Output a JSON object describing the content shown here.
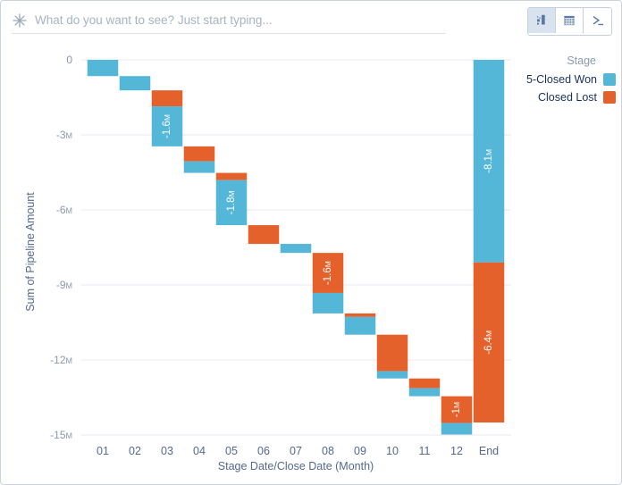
{
  "window": {
    "border_color": "#c9d2dc"
  },
  "search": {
    "placeholder": "What do you want to see? Just start typing...",
    "value": "",
    "icon": "sparkle-icon"
  },
  "toolbar": {
    "buttons": [
      {
        "name": "chart-view-button",
        "icon": "chart-icon",
        "active": true
      },
      {
        "name": "table-view-button",
        "icon": "table-grid-icon",
        "active": false
      },
      {
        "name": "console-view-button",
        "icon": "terminal-icon",
        "active": false
      }
    ]
  },
  "legend": {
    "title": "Stage",
    "items": [
      {
        "label": "5-Closed Won",
        "color": "#54b7d8"
      },
      {
        "label": "Closed Lost",
        "color": "#e4612c"
      }
    ]
  },
  "colors": {
    "won": "#54b7d8",
    "lost": "#e4612c",
    "gridline": "#e4eaf2",
    "axis_text": "#8a99ae",
    "axis_title": "#54698d",
    "toolbar_active": "#d8e3ef"
  },
  "chart_data": {
    "type": "bar",
    "subtype": "stacked-waterfall",
    "title": "",
    "xlabel": "Stage Date/Close Date (Month)",
    "ylabel": "Sum of Pipeline Amount",
    "ylim": [
      -15000000,
      0
    ],
    "yticks": [
      0,
      -3000000,
      -6000000,
      -9000000,
      -12000000,
      -15000000
    ],
    "ytick_labels": [
      "0",
      "-3M",
      "-6M",
      "-9M",
      "-12M",
      "-15M"
    ],
    "grid": true,
    "legend_position": "right",
    "categories": [
      "01",
      "02",
      "03",
      "04",
      "05",
      "06",
      "07",
      "08",
      "09",
      "10",
      "11",
      "12",
      "End"
    ],
    "series": [
      {
        "name": "5-Closed Won",
        "color": "#54b7d8",
        "values": [
          -650000,
          -570000,
          -1600000,
          -460000,
          -1800000,
          0,
          -360000,
          -820000,
          -710000,
          -290000,
          -320000,
          -460000,
          -8100000
        ]
      },
      {
        "name": "Closed Lost",
        "color": "#e4612c",
        "values": [
          0,
          0,
          -640000,
          -600000,
          -290000,
          -750000,
          0,
          -1600000,
          -140000,
          -1460000,
          -390000,
          -1070000,
          -6400000
        ]
      }
    ],
    "bars": [
      {
        "category": "01",
        "start": 0,
        "lost": 0,
        "won": -650000,
        "end": -650000,
        "label": ""
      },
      {
        "category": "02",
        "start": -650000,
        "lost": 0,
        "won": -570000,
        "end": -1220000,
        "label": ""
      },
      {
        "category": "03",
        "start": -1220000,
        "lost": -640000,
        "won": -1600000,
        "end": -3460000,
        "label": "-1.6M"
      },
      {
        "category": "04",
        "start": -3460000,
        "lost": -600000,
        "won": -460000,
        "end": -4520000,
        "label": ""
      },
      {
        "category": "05",
        "start": -4520000,
        "lost": -290000,
        "won": -1800000,
        "end": -6610000,
        "label": "-1.8M"
      },
      {
        "category": "06",
        "start": -6610000,
        "lost": -750000,
        "won": 0,
        "end": -7360000,
        "label": ""
      },
      {
        "category": "07",
        "start": -7360000,
        "lost": 0,
        "won": -360000,
        "end": -7720000,
        "label": ""
      },
      {
        "category": "08",
        "start": -7720000,
        "lost": -1600000,
        "won": -820000,
        "end": -10140000,
        "label": "-1.6M"
      },
      {
        "category": "09",
        "start": -10140000,
        "lost": -140000,
        "won": -710000,
        "end": -10990000,
        "label": ""
      },
      {
        "category": "10",
        "start": -10990000,
        "lost": -1460000,
        "won": -290000,
        "end": -12740000,
        "label": ""
      },
      {
        "category": "11",
        "start": -12740000,
        "lost": -390000,
        "won": -320000,
        "end": -13450000,
        "label": ""
      },
      {
        "category": "12",
        "start": -13450000,
        "lost": -1070000,
        "won": -460000,
        "end": -14980000,
        "label": "-1M"
      },
      {
        "category": "End",
        "start": 0,
        "won_total": -8100000,
        "lost_total": -6400000,
        "end": -14500000,
        "labels": [
          "-8.1M",
          "-6.4M"
        ]
      }
    ],
    "data_labels": [
      {
        "category": "03",
        "series": "5-Closed Won",
        "text": "-1.6M"
      },
      {
        "category": "05",
        "series": "5-Closed Won",
        "text": "-1.8M"
      },
      {
        "category": "08",
        "series": "Closed Lost",
        "text": "-1.6M"
      },
      {
        "category": "12",
        "series": "Closed Lost",
        "text": "-1M"
      },
      {
        "category": "End",
        "series": "5-Closed Won",
        "text": "-8.1M"
      },
      {
        "category": "End",
        "series": "Closed Lost",
        "text": "-6.4M"
      }
    ]
  }
}
